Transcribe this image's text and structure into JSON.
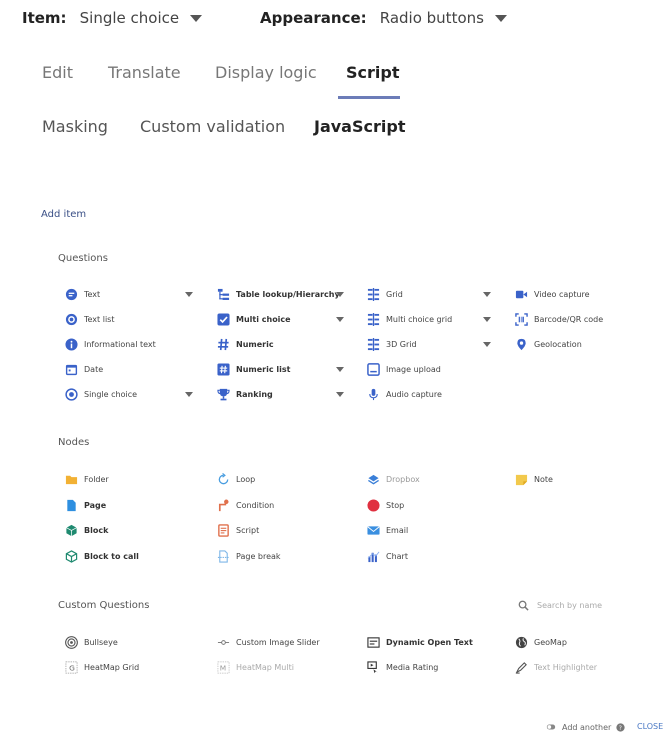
{
  "topbar": {
    "item_label": "Item:",
    "item_value": "Single choice",
    "appearance_label": "Appearance:",
    "appearance_value": "Radio buttons"
  },
  "tabs": [
    "Edit",
    "Translate",
    "Display logic",
    "Script"
  ],
  "subtabs": [
    "Masking",
    "Custom validation",
    "JavaScript"
  ],
  "add_item_title": "Add item",
  "questions": {
    "title": "Questions",
    "col1": [
      "Text",
      "Text list",
      "Informational text",
      "Date",
      "Single choice"
    ],
    "col2": [
      "Table lookup/Hierarchy",
      "Multi choice",
      "Numeric",
      "Numeric list",
      "Ranking"
    ],
    "col3": [
      "Grid",
      "Multi choice grid",
      "3D Grid",
      "Image upload",
      "Audio capture"
    ],
    "col4": [
      "Video capture",
      "Barcode/QR code",
      "Geolocation"
    ]
  },
  "nodes": {
    "title": "Nodes",
    "col1": [
      "Folder",
      "Page",
      "Block",
      "Block to call"
    ],
    "col2": [
      "Loop",
      "Condition",
      "Script",
      "Page break"
    ],
    "col3": [
      "Dropbox",
      "Stop",
      "Email",
      "Chart"
    ],
    "col4": [
      "Note"
    ]
  },
  "custom": {
    "title": "Custom Questions",
    "search_placeholder": "Search by name",
    "col1": [
      "Bullseye",
      "HeatMap Grid"
    ],
    "col2": [
      "Custom Image Slider",
      "HeatMap Multi"
    ],
    "col3": [
      "Dynamic Open Text",
      "Media Rating"
    ],
    "col4": [
      "GeoMap",
      "Text Highlighter"
    ]
  },
  "footer": {
    "add_another": "Add another",
    "close": "CLOSE"
  },
  "colors": {
    "accent": "#3a62c9",
    "underline": "#6c7cb8",
    "folder": "#f2b134",
    "stop": "#e03040",
    "condition": "#e0704c"
  }
}
